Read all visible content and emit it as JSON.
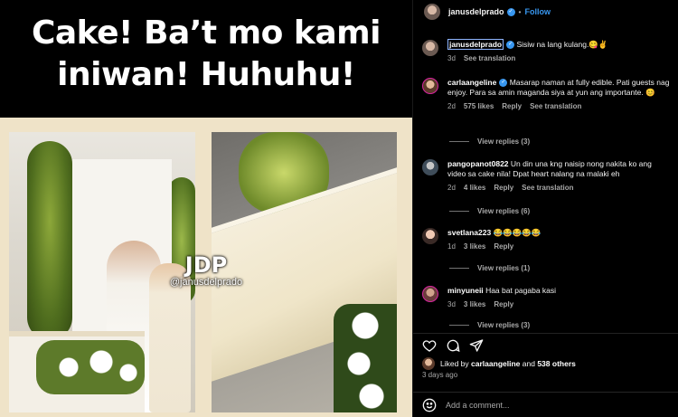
{
  "media": {
    "headline_line1": "Cake! Ba’t mo kami",
    "headline_line2": "iniwan! Huhuhu!",
    "watermark_logo": "JDP",
    "watermark_handle": "@janusdelprado"
  },
  "header": {
    "username": "janusdelprado",
    "follow_label": "Follow",
    "separator": "•"
  },
  "comments": [
    {
      "username": "janusdelprado",
      "verified": true,
      "text": "Sisiw na lang kulang.😋✌️",
      "time": "3d",
      "actions": [
        "See translation"
      ]
    },
    {
      "username": "carlaangeline",
      "verified": true,
      "text": "Masarap naman at fully edible. Pati guests nag enjoy. Para sa amin maganda siya at yun ang importante. 😊",
      "time": "2d",
      "likes": "575 likes",
      "actions": [
        "Reply",
        "See translation"
      ],
      "replies": "View replies (3)"
    },
    {
      "username": "pangopanot0822",
      "verified": false,
      "text": "Un din una kng naisip nong nakita ko ang video sa cake nila! Dpat heart nalang na malaki eh",
      "time": "2d",
      "likes": "4 likes",
      "actions": [
        "Reply",
        "See translation"
      ],
      "replies": "View replies (6)"
    },
    {
      "username": "svetlana223",
      "verified": false,
      "text": "😂😂😂😂😂",
      "time": "1d",
      "likes": "3 likes",
      "actions": [
        "Reply"
      ],
      "replies": "View replies (1)"
    },
    {
      "username": "minyuneii",
      "verified": false,
      "text": "Haa bat pagaba kasi",
      "time": "3d",
      "likes": "3 likes",
      "actions": [
        "Reply"
      ],
      "replies": "View replies (3)"
    }
  ],
  "actions": {
    "icons": [
      "heart-icon",
      "comment-icon",
      "share-icon"
    ]
  },
  "likes": {
    "prefix": "Liked by",
    "user": "carlaangeline",
    "joiner": "and",
    "others": "538 others"
  },
  "time_ago": "3 days ago",
  "add_comment": {
    "placeholder": "Add a comment..."
  },
  "colors": {
    "accent": "#3897f0",
    "background": "#000000",
    "muted": "#a8a8a8"
  }
}
